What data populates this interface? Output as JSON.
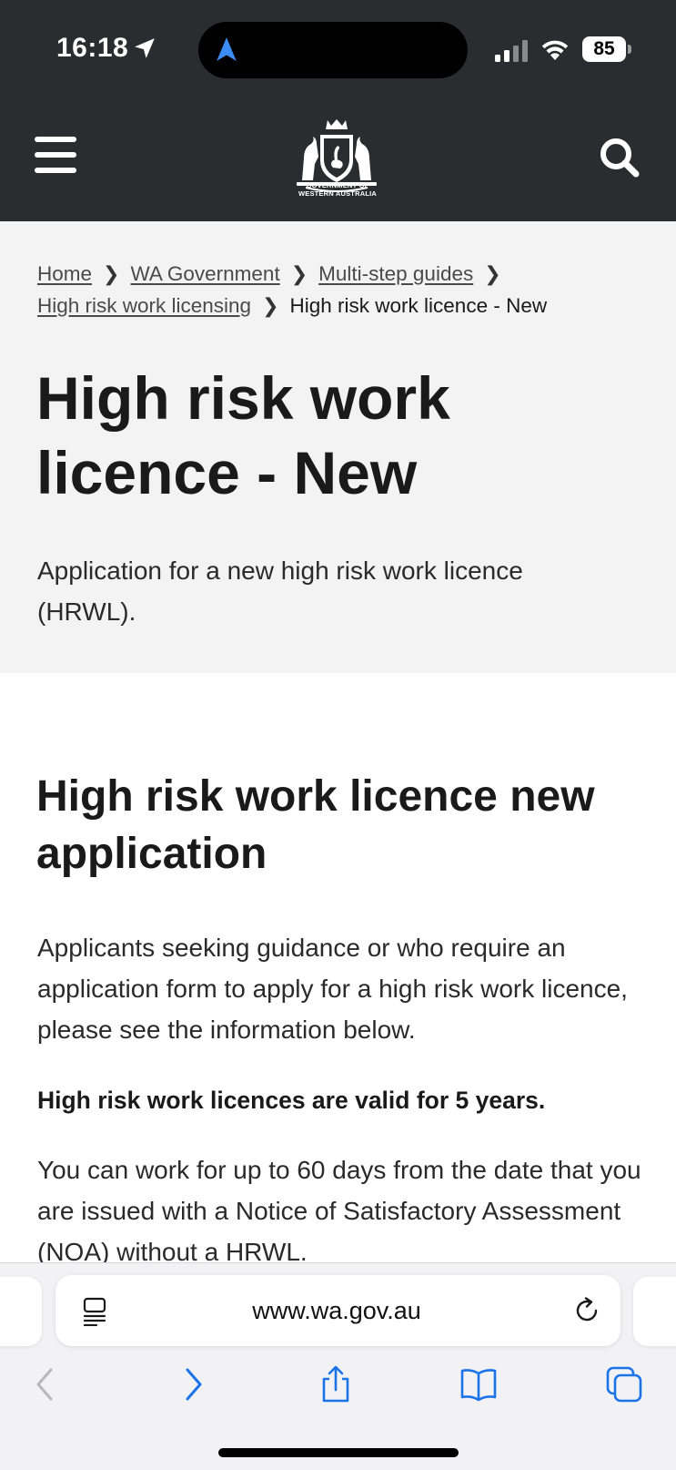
{
  "status_bar": {
    "time": "16:18",
    "battery": "85"
  },
  "header": {
    "logo_line1": "GOVERNMENT OF",
    "logo_line2": "WESTERN AUSTRALIA"
  },
  "breadcrumb": {
    "items": [
      "Home",
      "WA Government",
      "Multi-step guides",
      "High risk work licensing"
    ],
    "current": "High risk work licence - New"
  },
  "hero": {
    "title_line1": "High risk work",
    "title_line2": "licence - New",
    "subtitle": "Application for a new high risk work licence (HRWL)."
  },
  "content": {
    "heading": "High risk work licence new application",
    "paragraph_1": "Applicants seeking guidance or who require an application form to apply for a high risk work licence, please see the information below.",
    "paragraph_bold": "High risk work licences are valid for 5 years.",
    "paragraph_2": "You can work for up to 60 days from the date that you are issued with a Notice of Satisfactory Assessment (NOA) without a HRWL."
  },
  "browser": {
    "url": "www.wa.gov.au"
  },
  "colors": {
    "header_bg": "#2b2c30",
    "hero_bg": "#f3f3f3",
    "safari_blue": "#1a73e8",
    "location_blue": "#3b8cf5"
  }
}
